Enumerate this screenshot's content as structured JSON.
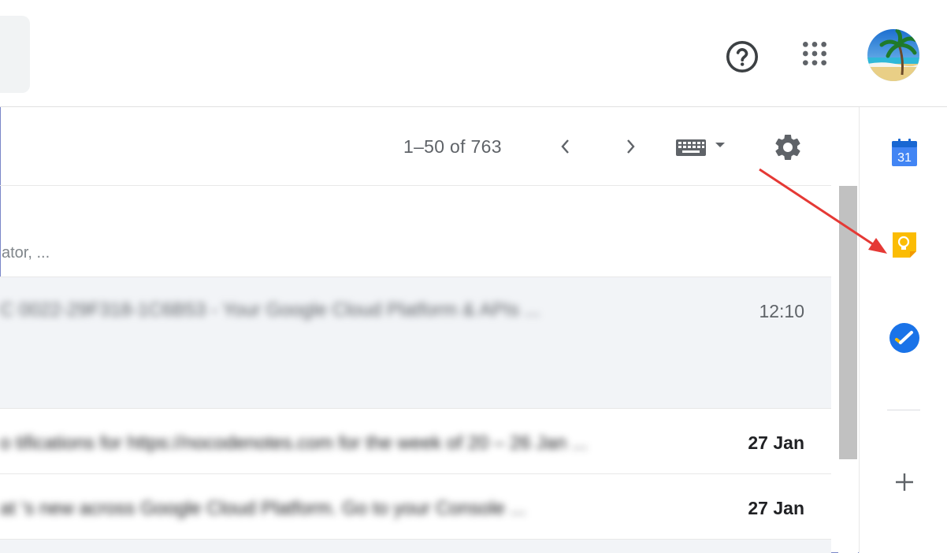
{
  "header": {
    "help_icon": "help-circle-icon",
    "apps_icon": "apps-grid-icon",
    "avatar_icon": "beach-palm-avatar"
  },
  "toolbar": {
    "pagination": "1–50 of 763",
    "prev_icon": "chevron-left-icon",
    "next_icon": "chevron-right-icon",
    "input_tools_icon": "keyboard-icon",
    "settings_icon": "gear-icon"
  },
  "list": {
    "tabs_snippet": "ator, ...",
    "rows": [
      {
        "text": "C  0022-29F318-1C6B53  -  Your Google Cloud Platform & APIs ...",
        "date": "12:10",
        "read": true,
        "selected": true
      },
      {
        "text": "o  tifications for https://nocodenotes.com for the week of 20 – 26 Jan ...",
        "date": "27 Jan",
        "read": false
      },
      {
        "text": "at  's new across Google Cloud Platform. Go to your Console ...",
        "date": "27 Jan",
        "read": false
      }
    ]
  },
  "side_panel": {
    "calendar_number": "31",
    "calendar_icon": "google-calendar-icon",
    "keep_icon": "google-keep-lightbulb-icon",
    "tasks_icon": "google-tasks-check-icon",
    "add_icon": "plus-icon"
  },
  "annotation": {
    "arrow_color": "#e53935"
  },
  "colors": {
    "calendar_blue": "#4285f4",
    "keep_yellow": "#fbbc04",
    "tasks_blue": "#1a73e8",
    "selected_row_bg": "#f2f4f7"
  }
}
